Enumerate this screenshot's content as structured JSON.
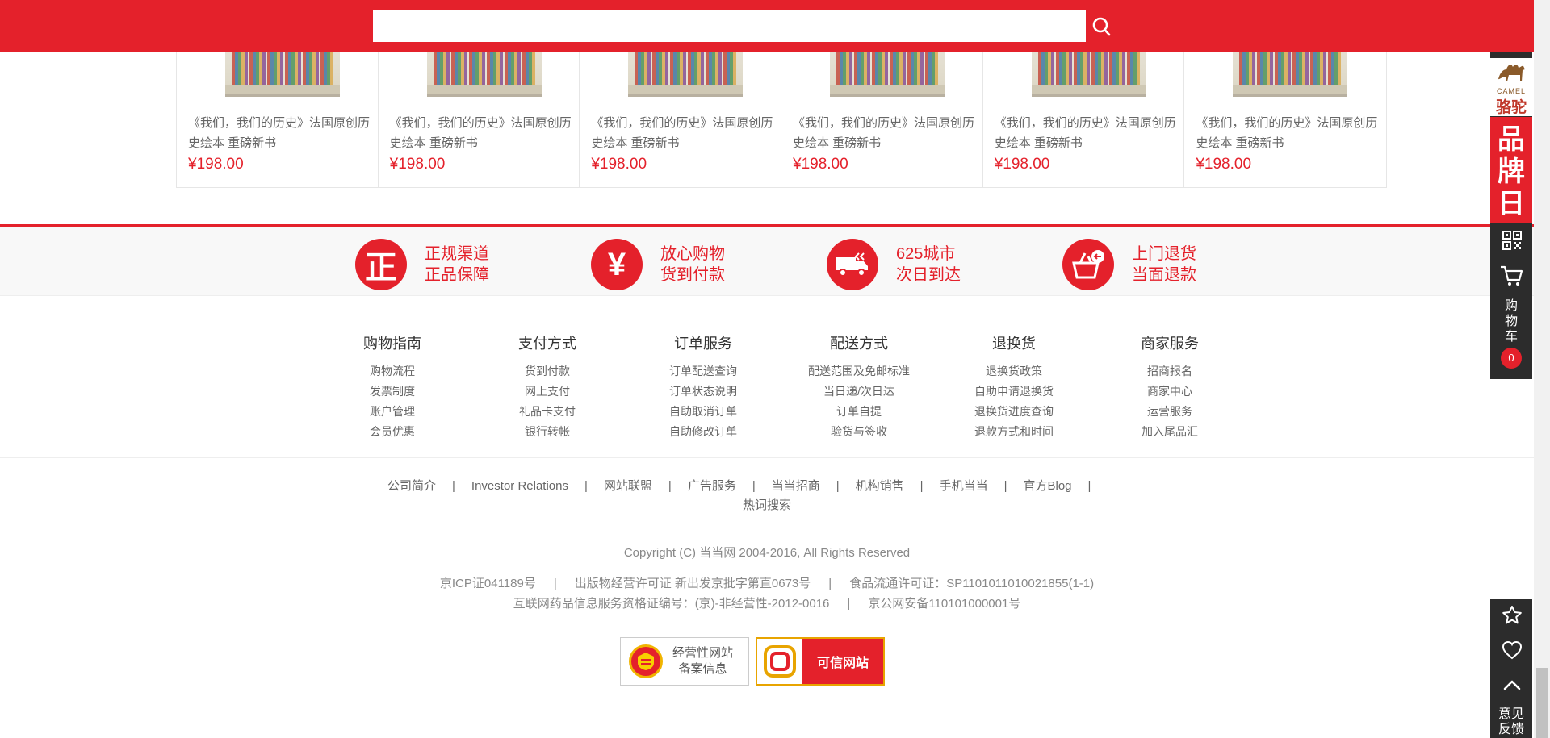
{
  "search": {
    "value": "",
    "placeholder": "",
    "button_icon": "search-icon"
  },
  "products": [
    {
      "title": "《我们，我们的历史》法国原创历史绘本 重磅新书",
      "price": "¥198.00"
    },
    {
      "title": "《我们，我们的历史》法国原创历史绘本 重磅新书",
      "price": "¥198.00"
    },
    {
      "title": "《我们，我们的历史》法国原创历史绘本 重磅新书",
      "price": "¥198.00"
    },
    {
      "title": "《我们，我们的历史》法国原创历史绘本 重磅新书",
      "price": "¥198.00"
    },
    {
      "title": "《我们，我们的历史》法国原创历史绘本 重磅新书",
      "price": "¥198.00"
    },
    {
      "title": "《我们，我们的历史》法国原创历史绘本 重磅新书",
      "price": "¥198.00"
    }
  ],
  "guarantees": [
    {
      "glyph": "正",
      "line1": "正规渠道",
      "line2": "正品保障"
    },
    {
      "glyph": "¥",
      "line1": "放心购物",
      "line2": "货到付款"
    },
    {
      "glyph": "truck-icon",
      "line1": "625城市",
      "line2": "次日到达"
    },
    {
      "glyph": "return-basket-icon",
      "line1": "上门退货",
      "line2": "当面退款"
    }
  ],
  "help": [
    {
      "title": "购物指南",
      "links": [
        "购物流程",
        "发票制度",
        "账户管理",
        "会员优惠"
      ]
    },
    {
      "title": "支付方式",
      "links": [
        "货到付款",
        "网上支付",
        "礼品卡支付",
        "银行转帐"
      ]
    },
    {
      "title": "订单服务",
      "links": [
        "订单配送查询",
        "订单状态说明",
        "自助取消订单",
        "自助修改订单"
      ]
    },
    {
      "title": "配送方式",
      "links": [
        "配送范围及免邮标准",
        "当日递/次日达",
        "订单自提",
        "验货与签收"
      ]
    },
    {
      "title": "退换货",
      "links": [
        "退换货政策",
        "自助申请退换货",
        "退换货进度查询",
        "退款方式和时间"
      ]
    },
    {
      "title": "商家服务",
      "links": [
        "招商报名",
        "商家中心",
        "运营服务",
        "加入尾品汇"
      ]
    }
  ],
  "footer_links": [
    "公司简介",
    "Investor Relations",
    "网站联盟",
    "广告服务",
    "当当招商",
    "机构销售",
    "手机当当",
    "官方Blog"
  ],
  "footer_hotword": "热词搜索",
  "separator": "|",
  "copyright": "Copyright (C) 当当网 2004-2016, All Rights Reserved",
  "licenses_line1": [
    "京ICP证041189号",
    "出版物经营许可证 新出发京批字第直0673号",
    "食品流通许可证：SP1101011010021855(1-1)"
  ],
  "licenses_line2": [
    "互联网药品信息服务资格证编号：(京)-非经营性-2012-0016",
    "京公网安备110101000001号"
  ],
  "badges": {
    "badge1_line1": "经营性网站",
    "badge1_line2": "备案信息",
    "badge2_text": "可信网站"
  },
  "sidebar": {
    "camel_brand": "CAMEL",
    "camel_name": "骆驼",
    "brand_day": [
      "品",
      "牌",
      "日"
    ],
    "cart_label": [
      "购",
      "物",
      "车"
    ],
    "cart_count": "0",
    "feedback": [
      "意见",
      "反馈"
    ]
  },
  "colors": {
    "accent": "#e4212b",
    "sidebar": "#2c2c2c",
    "text": "#666666"
  }
}
